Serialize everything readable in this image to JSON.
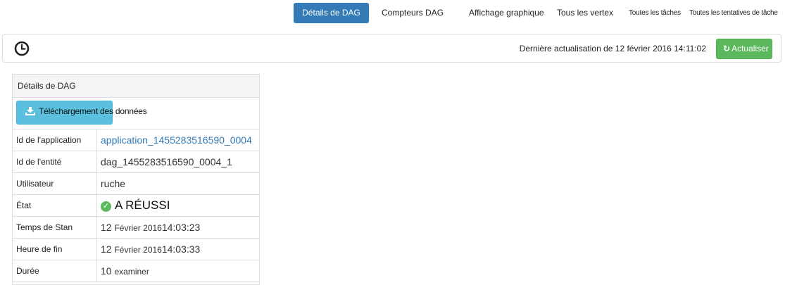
{
  "tabs": {
    "dag_details": "Détails de DAG",
    "dag_counters": "Compteurs DAG",
    "graphical_view": "Affichage graphique",
    "all_vertices": "Tous les vertex",
    "all_tasks": "Toutes les tâches",
    "all_task_attempts": "Toutes les tentatives de tâche"
  },
  "refresh_bar": {
    "last_refresh": "Dernière actualisation de 12 février 2016 14:11:02",
    "refresh_button": "Actualiser",
    "icons": {
      "clock": "clock-icon",
      "refresh": "refresh-icon"
    }
  },
  "colors": {
    "accent": "#337ab7",
    "success": "#5cb85c",
    "info": "#5bc0de"
  },
  "panel": {
    "title": "Détails de DAG",
    "download_button": "Téléchargement des données",
    "download_icon": "download-icon",
    "rows": {
      "application_id": {
        "key": "Id de l'application",
        "value": "application_1455283516590_0004"
      },
      "entity_id": {
        "key": "Id de l'entité",
        "value": "dag_1455283516590_0004_1"
      },
      "user": {
        "key": "Utilisateur",
        "value": "ruche"
      },
      "state": {
        "key": "État",
        "value": "A RÉUSSI",
        "icon": "check-circle-icon"
      },
      "start_time": {
        "key": "Temps de Stan",
        "day": "12",
        "month_year": "Février 2016",
        "time": "14:03:23"
      },
      "end_time": {
        "key": "Heure de fin",
        "day": "12",
        "month_year": "Février 2016",
        "time": "14:03:33"
      },
      "duration": {
        "key": "Durée",
        "number": "10",
        "unit": "examiner"
      }
    }
  }
}
